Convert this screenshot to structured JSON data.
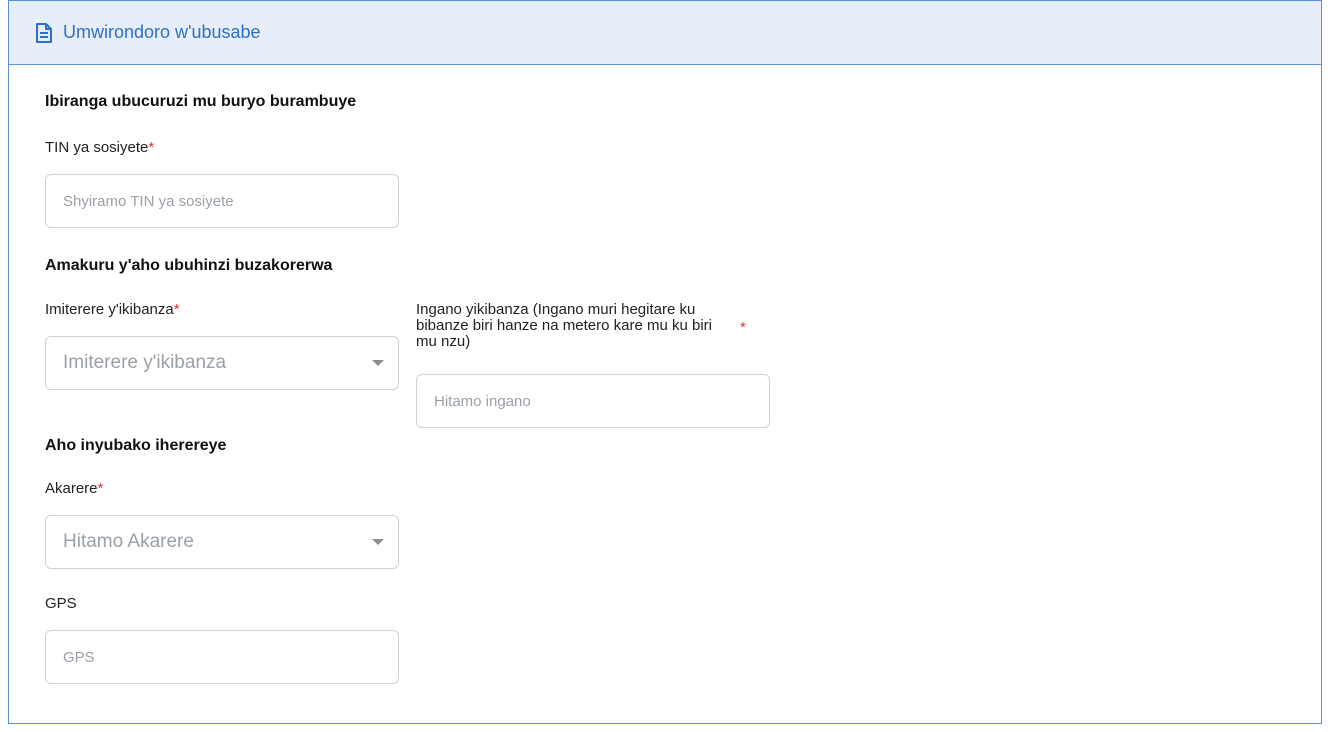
{
  "header": {
    "title": "Umwirondoro w'ubusabe",
    "icon": "document-icon"
  },
  "sections": {
    "business": {
      "title": "Ibiranga ubucuruzi mu buryo burambuye",
      "tin_label": "TIN ya sosiyete",
      "tin_placeholder": "Shyiramo TIN ya sosiyete"
    },
    "work": {
      "title": "Amakuru y'aho ubuhinzi buzakorerwa",
      "plot_type_label": "Imiterere y'ikibanza",
      "plot_type_value": "Imiterere y'ikibanza",
      "plot_size_label": "Ingano yikibanza (Ingano muri hegitare ku bibanze biri hanze na metero kare mu ku biri mu nzu)",
      "plot_size_placeholder": "Hitamo ingano"
    },
    "location": {
      "title": "Aho inyubako iherereye",
      "district_label": "Akarere",
      "district_value": "Hitamo Akarere",
      "gps_label": "GPS",
      "gps_placeholder": "GPS"
    }
  },
  "required_mark": "*",
  "colors": {
    "accent": "#2f6fc8",
    "border": "#5b8fd6",
    "header_bg": "#e6eef9",
    "required": "#d9363e"
  }
}
